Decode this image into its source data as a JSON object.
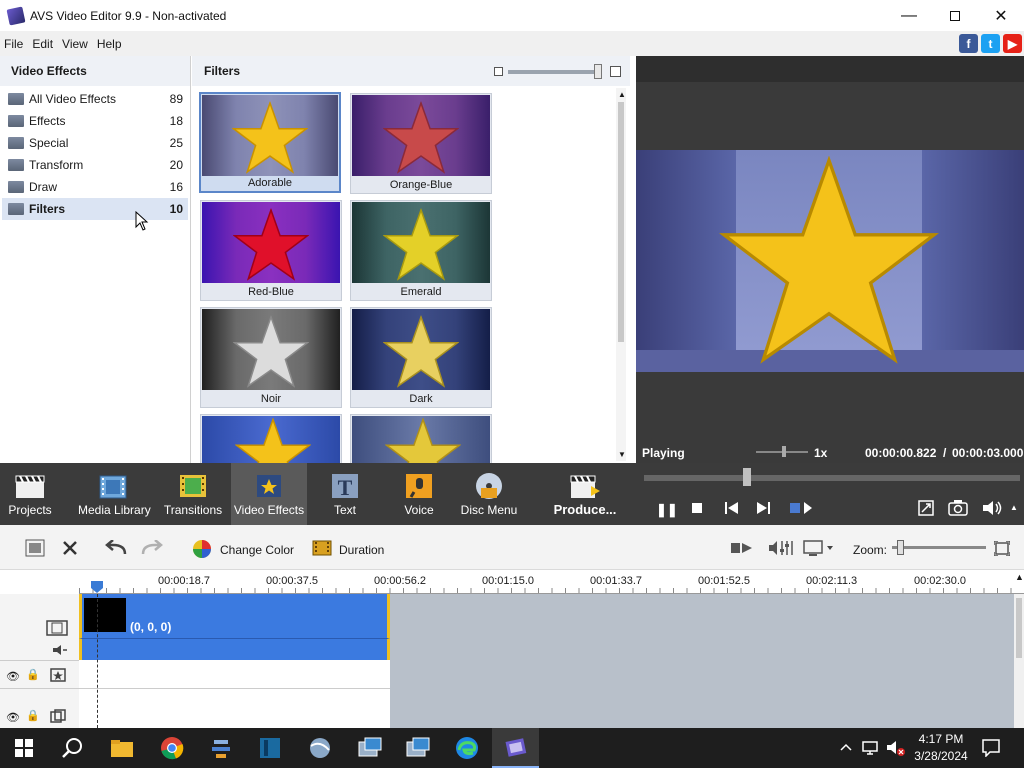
{
  "window": {
    "title": "AVS Video Editor 9.9 - Non-activated"
  },
  "menu": [
    "File",
    "Edit",
    "View",
    "Help"
  ],
  "left_panel": {
    "title": "Video Effects",
    "categories": [
      {
        "label": "All Video Effects",
        "count": "89"
      },
      {
        "label": "Effects",
        "count": "18"
      },
      {
        "label": "Special",
        "count": "25"
      },
      {
        "label": "Transform",
        "count": "20"
      },
      {
        "label": "Draw",
        "count": "16"
      },
      {
        "label": "Filters",
        "count": "10",
        "selected": true
      }
    ]
  },
  "effects_panel": {
    "title": "Filters",
    "thumbs": [
      {
        "label": "Adorable",
        "selected": true
      },
      {
        "label": "Orange-Blue"
      },
      {
        "label": "Red-Blue"
      },
      {
        "label": "Emerald"
      },
      {
        "label": "Noir"
      },
      {
        "label": "Dark"
      }
    ]
  },
  "preview": {
    "status": "Playing",
    "speed": "1x",
    "current_time": "00:00:00.822",
    "separator": "/",
    "total_time": "00:00:03.000"
  },
  "toolbar": {
    "projects": "Projects",
    "media_library": "Media Library",
    "transitions": "Transitions",
    "video_effects": "Video Effects",
    "text": "Text",
    "voice": "Voice",
    "disc_menu": "Disc Menu",
    "produce": "Produce..."
  },
  "edit_toolbar": {
    "change_color": "Change Color",
    "duration": "Duration",
    "zoom": "Zoom:"
  },
  "timeline": {
    "ticks": [
      "00:00:18.7",
      "00:00:37.5",
      "00:00:56.2",
      "00:01:15.0",
      "00:01:33.7",
      "00:01:52.5",
      "00:02:11.3",
      "00:02:30.0"
    ],
    "clip_label": "(0, 0, 0)"
  },
  "taskbar": {
    "time": "4:17 PM",
    "date": "3/28/2024"
  },
  "colors": {
    "accent": "#3a7bd5",
    "clip": "#3b7ae0",
    "dark": "#3b3b3b"
  }
}
